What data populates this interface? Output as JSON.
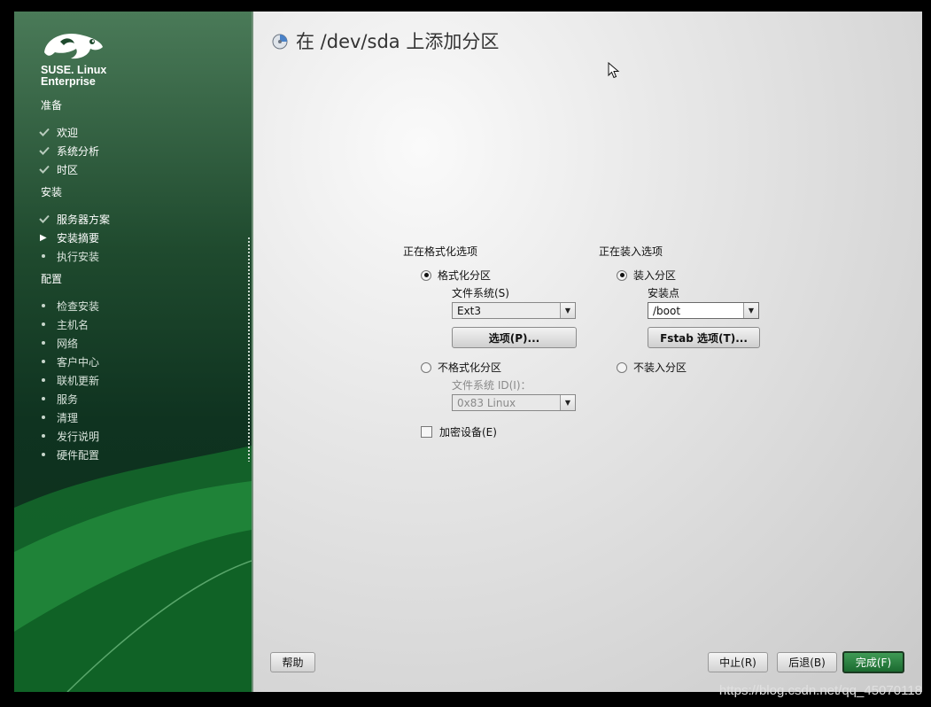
{
  "window": {
    "title": "在 /dev/sda 上添加分区"
  },
  "brand": {
    "line1": "SUSE. Linux",
    "line2": "Enterprise"
  },
  "sidebar": {
    "sections": [
      {
        "label": "准备",
        "steps": [
          {
            "label": "欢迎",
            "state": "done"
          },
          {
            "label": "系统分析",
            "state": "done"
          },
          {
            "label": "时区",
            "state": "done"
          }
        ]
      },
      {
        "label": "安装",
        "steps": [
          {
            "label": "服务器方案",
            "state": "done"
          },
          {
            "label": "安装摘要",
            "state": "current"
          },
          {
            "label": "执行安装",
            "state": "pending"
          }
        ]
      },
      {
        "label": "配置",
        "steps": [
          {
            "label": "检查安装",
            "state": "pending"
          },
          {
            "label": "主机名",
            "state": "pending"
          },
          {
            "label": "网络",
            "state": "pending"
          },
          {
            "label": "客户中心",
            "state": "pending"
          },
          {
            "label": "联机更新",
            "state": "pending"
          },
          {
            "label": "服务",
            "state": "pending"
          },
          {
            "label": "清理",
            "state": "pending"
          },
          {
            "label": "发行说明",
            "state": "pending"
          },
          {
            "label": "硬件配置",
            "state": "pending"
          }
        ]
      }
    ]
  },
  "format": {
    "group_label": "正在格式化选项",
    "format_radio": "格式化分区",
    "fs_label": "文件系统(S)",
    "fs_value": "Ext3",
    "options_button": "选项(P)...",
    "noformat_radio": "不格式化分区",
    "fsid_label": "文件系统 ID(I)：",
    "fsid_value": "0x83 Linux",
    "encrypt_label": "加密设备(E)"
  },
  "mount": {
    "group_label": "正在装入选项",
    "mount_radio": "装入分区",
    "mountpoint_label": "安装点",
    "mountpoint_value": "/boot",
    "fstab_button": "Fstab 选项(T)...",
    "nomount_radio": "不装入分区"
  },
  "footer": {
    "help": "帮助",
    "abort": "中止(R)",
    "back": "后退(B)",
    "finish": "完成(F)"
  },
  "watermark": "https://blog.csdn.net/qq_45070118",
  "colors": {
    "accent_green": "#1b6a30",
    "sidebar_dark": "#0f3320"
  }
}
